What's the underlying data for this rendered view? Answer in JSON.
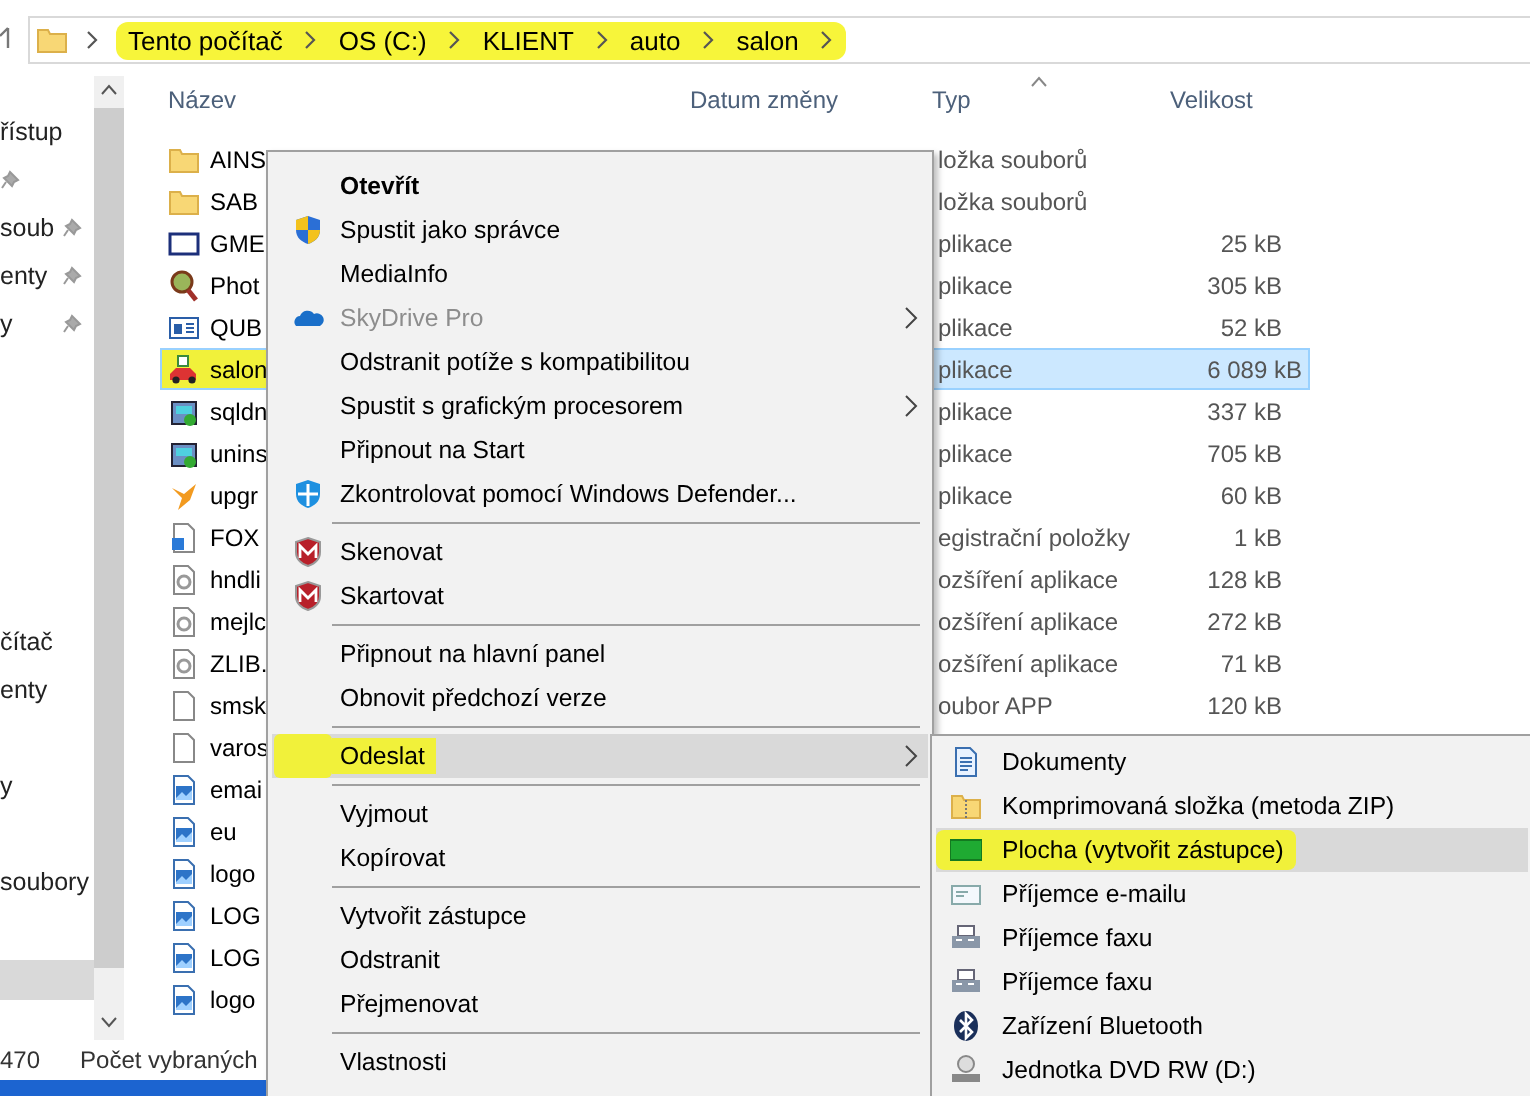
{
  "address_bar": {
    "marked": true,
    "crumbs": [
      "Tento počítač",
      "OS (C:)",
      "KLIENT",
      "auto",
      "salon"
    ]
  },
  "navigation_pane": {
    "top_items": [
      {
        "label": "řístup",
        "pinned": false
      },
      {
        "pinned": true
      },
      {
        "label": "soub",
        "pinned": true
      },
      {
        "label": "enty",
        "pinned": true
      },
      {
        "label": "y",
        "pinned": true
      }
    ],
    "lower_items": [
      "čítač",
      "enty",
      "y",
      "soubory"
    ]
  },
  "file_list": {
    "columns": [
      "Název",
      "Datum změny",
      "Typ",
      "Velikost"
    ],
    "rows": [
      {
        "name": "AINS",
        "type": "ložka souborů",
        "selected": false
      },
      {
        "name": "SAB",
        "type": "ložka souborů",
        "selected": false
      },
      {
        "name": "GME",
        "type": "plikace",
        "size": "25 kB",
        "selected": false
      },
      {
        "name": "Phot",
        "type": "plikace",
        "size": "305 kB",
        "selected": false
      },
      {
        "name": "QUB",
        "type": "plikace",
        "size": "52 kB",
        "selected": false
      },
      {
        "name": "salon",
        "type": "plikace",
        "size": "6 089 kB",
        "selected": true
      },
      {
        "name": "sqldn",
        "type": "plikace",
        "size": "337 kB",
        "selected": false
      },
      {
        "name": "unins",
        "type": "plikace",
        "size": "705 kB",
        "selected": false
      },
      {
        "name": "upgr",
        "type": "plikace",
        "size": "60 kB",
        "selected": false
      },
      {
        "name": "FOX",
        "type": "egistrační položky",
        "size": "1 kB",
        "selected": false
      },
      {
        "name": "hndli",
        "type": "ozšíření aplikace",
        "size": "128 kB",
        "selected": false
      },
      {
        "name": "mejlc",
        "type": "ozšíření aplikace",
        "size": "272 kB",
        "selected": false
      },
      {
        "name": "ZLIB.",
        "type": "ozšíření aplikace",
        "size": "71 kB",
        "selected": false
      },
      {
        "name": "smsk",
        "type": "oubor APP",
        "size": "120 kB",
        "selected": false
      },
      {
        "name": "varos",
        "selected": false
      },
      {
        "name": "emai",
        "selected": false
      },
      {
        "name": "eu",
        "selected": false
      },
      {
        "name": "logo",
        "selected": false
      },
      {
        "name": "LOG",
        "selected": false
      },
      {
        "name": "LOG",
        "selected": false
      },
      {
        "name": "logo",
        "selected": false
      }
    ]
  },
  "status_bar": [
    "470",
    "Počet vybraných"
  ],
  "context_menu": {
    "items": [
      {
        "kind": "item",
        "label": "Otevřít",
        "default": true,
        "disabled": false,
        "submenu": false,
        "selected": false,
        "marked": false
      },
      {
        "kind": "item",
        "label": "Spustit jako správce",
        "default": false,
        "disabled": false,
        "submenu": false,
        "selected": false,
        "marked": false
      },
      {
        "kind": "item",
        "label": "MediaInfo",
        "default": false,
        "disabled": false,
        "submenu": false,
        "selected": false,
        "marked": false
      },
      {
        "kind": "item",
        "label": "SkyDrive Pro",
        "default": false,
        "disabled": true,
        "submenu": true,
        "selected": false,
        "marked": false
      },
      {
        "kind": "item",
        "label": "Odstranit potíže s kompatibilitou",
        "default": false,
        "disabled": false,
        "submenu": false,
        "selected": false,
        "marked": false
      },
      {
        "kind": "item",
        "label": "Spustit s grafickým procesorem",
        "default": false,
        "disabled": false,
        "submenu": true,
        "selected": false,
        "marked": false
      },
      {
        "kind": "item",
        "label": "Připnout na Start",
        "default": false,
        "disabled": false,
        "submenu": false,
        "selected": false,
        "marked": false
      },
      {
        "kind": "item",
        "label": "Zkontrolovat pomocí Windows Defender...",
        "default": false,
        "disabled": false,
        "submenu": false,
        "selected": false,
        "marked": false
      },
      {
        "kind": "separator"
      },
      {
        "kind": "item",
        "label": "Skenovat",
        "default": false,
        "disabled": false,
        "submenu": false,
        "selected": false,
        "marked": false
      },
      {
        "kind": "item",
        "label": "Skartovat",
        "default": false,
        "disabled": false,
        "submenu": false,
        "selected": false,
        "marked": false
      },
      {
        "kind": "separator"
      },
      {
        "kind": "item",
        "label": "Připnout na hlavní panel",
        "default": false,
        "disabled": false,
        "submenu": false,
        "selected": false,
        "marked": false
      },
      {
        "kind": "item",
        "label": "Obnovit předchozí verze",
        "default": false,
        "disabled": false,
        "submenu": false,
        "selected": false,
        "marked": false
      },
      {
        "kind": "separator"
      },
      {
        "kind": "item",
        "label": "Odeslat",
        "default": false,
        "disabled": false,
        "submenu": true,
        "selected": true,
        "marked": true
      },
      {
        "kind": "separator"
      },
      {
        "kind": "item",
        "label": "Vyjmout",
        "default": false,
        "disabled": false,
        "submenu": false,
        "selected": false,
        "marked": false
      },
      {
        "kind": "item",
        "label": "Kopírovat",
        "default": false,
        "disabled": false,
        "submenu": false,
        "selected": false,
        "marked": false
      },
      {
        "kind": "separator"
      },
      {
        "kind": "item",
        "label": "Vytvořit zástupce",
        "default": false,
        "disabled": false,
        "submenu": false,
        "selected": false,
        "marked": false
      },
      {
        "kind": "item",
        "label": "Odstranit",
        "default": false,
        "disabled": false,
        "submenu": false,
        "selected": false,
        "marked": false
      },
      {
        "kind": "item",
        "label": "Přejmenovat",
        "default": false,
        "disabled": false,
        "submenu": false,
        "selected": false,
        "marked": false
      },
      {
        "kind": "separator"
      },
      {
        "kind": "item",
        "label": "Vlastnosti",
        "default": false,
        "disabled": false,
        "submenu": false,
        "selected": false,
        "marked": false
      }
    ]
  },
  "send_to_menu": {
    "items": [
      {
        "label": "Dokumenty",
        "selected": false,
        "marked": false
      },
      {
        "label": "Komprimovaná složka (metoda ZIP)",
        "selected": false,
        "marked": false
      },
      {
        "label": "Plocha (vytvořit zástupce)",
        "selected": true,
        "marked": true
      },
      {
        "label": "Příjemce e-mailu",
        "selected": false,
        "marked": false
      },
      {
        "label": "Příjemce faxu",
        "selected": false,
        "marked": false
      },
      {
        "label": "Příjemce faxu",
        "selected": false,
        "marked": false
      },
      {
        "label": "Zařízení Bluetooth",
        "selected": false,
        "marked": false
      },
      {
        "label": "Jednotka DVD RW (D:)",
        "selected": false,
        "marked": false
      }
    ]
  }
}
